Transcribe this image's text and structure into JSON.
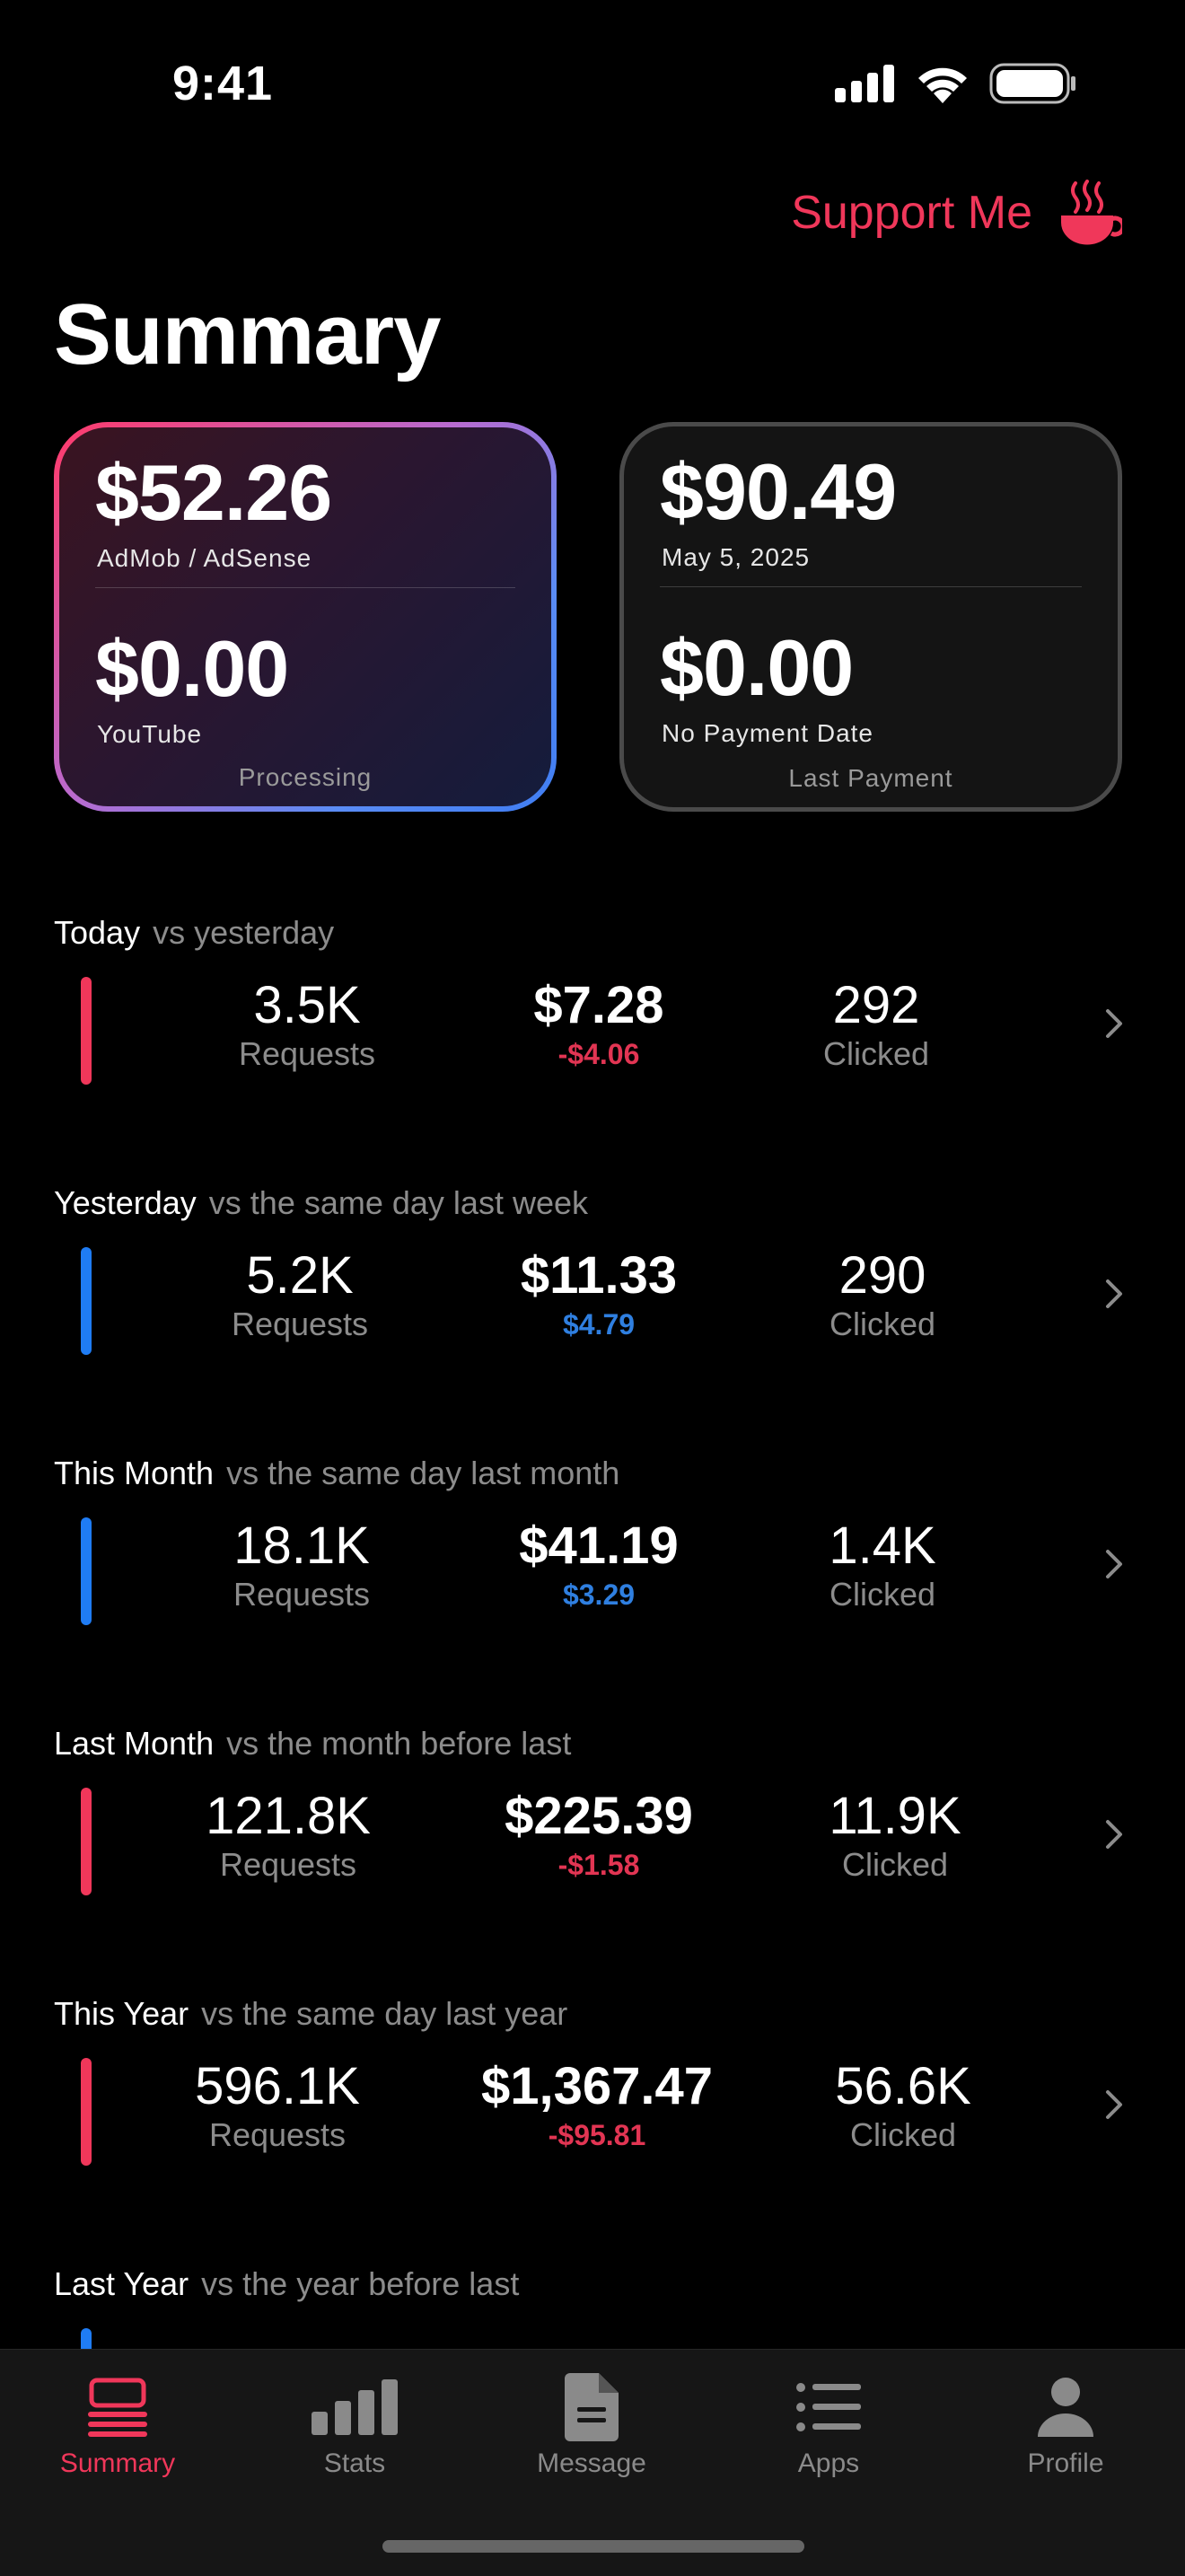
{
  "status": {
    "time": "9:41"
  },
  "support": {
    "label": "Support Me",
    "icon": "coffee-cup-icon"
  },
  "title": "Summary",
  "cards": [
    {
      "amount_top": "$52.26",
      "label_top": "AdMob / AdSense",
      "amount_bottom": "$0.00",
      "label_bottom": "YouTube",
      "footer": "Processing"
    },
    {
      "amount_top": "$90.49",
      "label_top": "May 5, 2025",
      "amount_bottom": "$0.00",
      "label_bottom": "No Payment Date",
      "footer": "Last Payment"
    }
  ],
  "sections": [
    {
      "title": "Today",
      "subtitle": "vs yesterday",
      "bar_color": "#f0375a",
      "requests": "3.5K",
      "requests_label": "Requests",
      "earnings": "$7.28",
      "delta": "-$4.06",
      "delta_color": "#e23553",
      "clicks": "292",
      "clicks_label": "Clicked"
    },
    {
      "title": "Yesterday",
      "subtitle": "vs the same day last week",
      "bar_color": "#1f7cf4",
      "requests": "5.2K",
      "requests_label": "Requests",
      "earnings": "$11.33",
      "delta": "$4.79",
      "delta_color": "#2f7fe0",
      "clicks": "290",
      "clicks_label": "Clicked"
    },
    {
      "title": "This Month",
      "subtitle": "vs the same day last month",
      "bar_color": "#1f7cf4",
      "requests": "18.1K",
      "requests_label": "Requests",
      "earnings": "$41.19",
      "delta": "$3.29",
      "delta_color": "#2f7fe0",
      "clicks": "1.4K",
      "clicks_label": "Clicked"
    },
    {
      "title": "Last Month",
      "subtitle": "vs the month before last",
      "bar_color": "#f0375a",
      "requests": "121.8K",
      "requests_label": "Requests",
      "earnings": "$225.39",
      "delta": "-$1.58",
      "delta_color": "#e23553",
      "clicks": "11.9K",
      "clicks_label": "Clicked"
    },
    {
      "title": "This Year",
      "subtitle": "vs the same day last year",
      "bar_color": "#f0375a",
      "requests": "596.1K",
      "requests_label": "Requests",
      "earnings": "$1,367.47",
      "delta": "-$95.81",
      "delta_color": "#e23553",
      "clicks": "56.6K",
      "clicks_label": "Clicked"
    },
    {
      "title": "Last Year",
      "subtitle": "vs the year before last",
      "bar_color": "#1f7cf4"
    }
  ],
  "tabs": [
    {
      "label": "Summary",
      "icon": "summary-list-icon",
      "active": true
    },
    {
      "label": "Stats",
      "icon": "bar-chart-icon",
      "active": false
    },
    {
      "label": "Message",
      "icon": "document-icon",
      "active": false
    },
    {
      "label": "Apps",
      "icon": "list-icon",
      "active": false
    },
    {
      "label": "Profile",
      "icon": "person-icon",
      "active": false
    }
  ],
  "colors": {
    "accent": "#f0375a",
    "negative": "#e23553",
    "positive": "#2f7fe0",
    "blue_bar": "#1f7cf4"
  }
}
